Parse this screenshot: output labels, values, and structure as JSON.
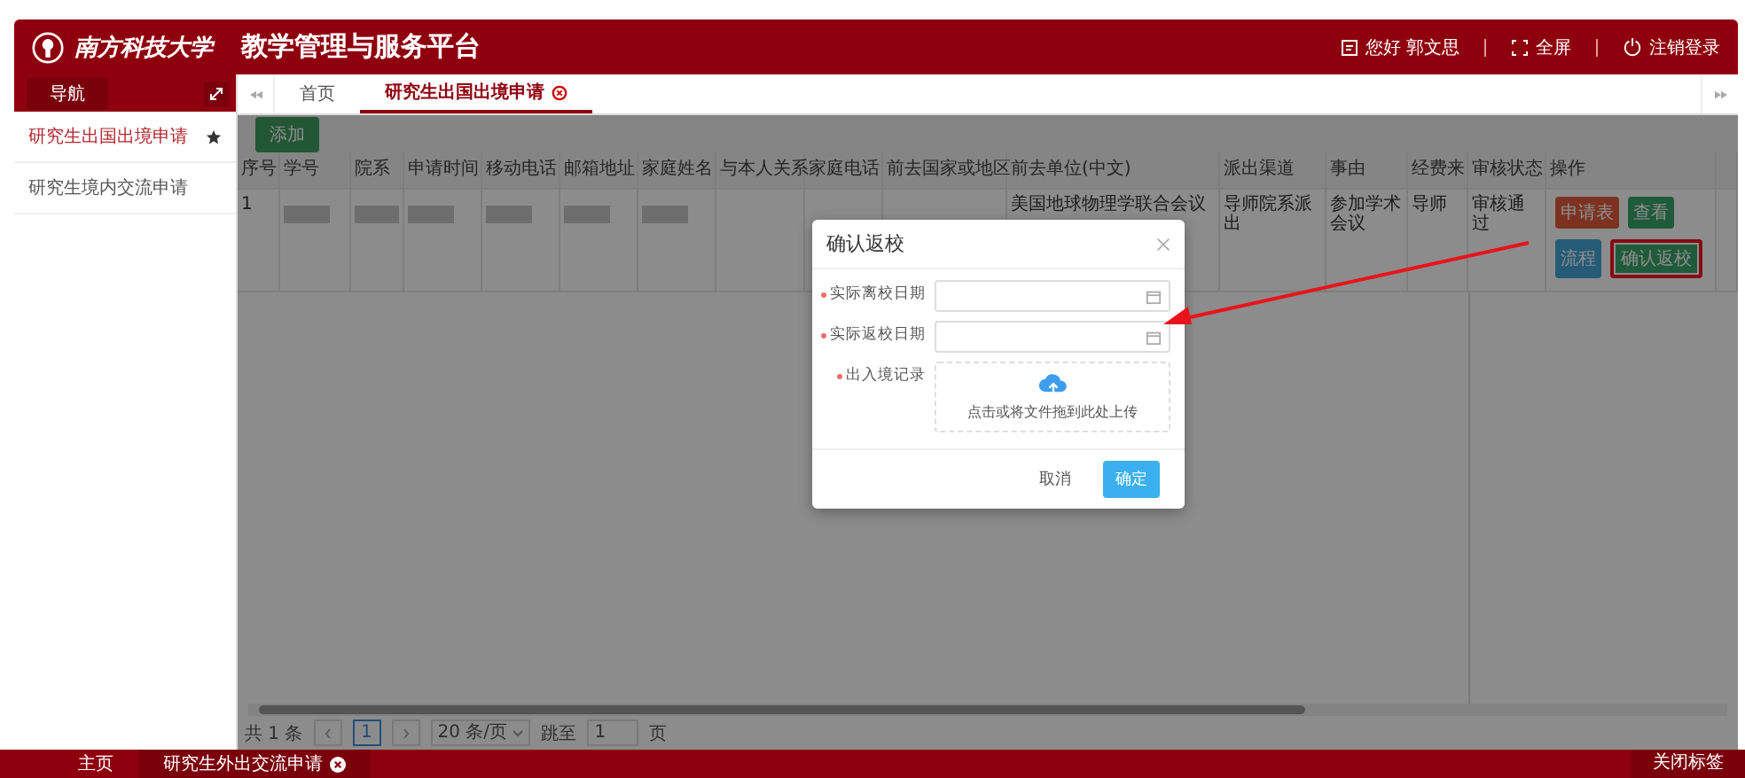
{
  "header": {
    "school_name": "南方科技大学",
    "title": "教学管理与服务平台",
    "greeting": "您好 郭文思",
    "fullscreen": "全屏",
    "logout": "注销登录"
  },
  "sidebar": {
    "nav_label": "导航",
    "items": [
      {
        "label": "研究生出国出境申请",
        "selected": true,
        "starred": true
      },
      {
        "label": "研究生境内交流申请",
        "selected": false,
        "starred": false
      }
    ]
  },
  "tabs": [
    {
      "label": "首页",
      "selected": false,
      "closable": false
    },
    {
      "label": "研究生出国出境申请",
      "selected": true,
      "closable": true
    }
  ],
  "toolbar": {
    "add": "添加"
  },
  "table": {
    "columns": [
      "序号",
      "学号",
      "院系",
      "申请时间",
      "移动电话",
      "邮箱地址",
      "家庭姓名",
      "与本人关系",
      "家庭电话",
      "前去国家或地区",
      "前去单位(中文)",
      "派出渠道",
      "事由",
      "经费来",
      "审核状态",
      "操作"
    ],
    "rows": [
      {
        "cells": [
          {
            "kind": "text",
            "text": "1"
          },
          {
            "kind": "blurred"
          },
          {
            "kind": "blurred"
          },
          {
            "kind": "blurred"
          },
          {
            "kind": "blurred"
          },
          {
            "kind": "blurred"
          },
          {
            "kind": "blurred"
          },
          {
            "kind": "empty"
          },
          {
            "kind": "empty"
          },
          {
            "kind": "empty"
          },
          {
            "kind": "text",
            "text": "美国地球物理学联合会议"
          },
          {
            "kind": "text",
            "text": "导师院系派出"
          },
          {
            "kind": "text",
            "text": "参加学术会议"
          },
          {
            "kind": "text",
            "text": "导师"
          },
          {
            "kind": "text",
            "text": "审核通过"
          },
          {
            "kind": "actions",
            "buttons": [
              {
                "label": "申请表",
                "kind": "danger",
                "highlighted": false
              },
              {
                "label": "查看",
                "kind": "success",
                "highlighted": false
              },
              {
                "label": "流程",
                "kind": "info",
                "highlighted": false
              },
              {
                "label": "确认返校",
                "kind": "success",
                "highlighted": true
              }
            ]
          }
        ]
      }
    ]
  },
  "pagination": {
    "total": "共 1 条",
    "page": "1",
    "page_size": "20 条/页",
    "jump_label": "跳至",
    "jump_value": "1",
    "page_unit": "页"
  },
  "dialog": {
    "title": "确认返校",
    "fields": [
      {
        "label": "实际离校日期",
        "required": true,
        "kind": "date"
      },
      {
        "label": "实际返校日期",
        "required": true,
        "kind": "date"
      },
      {
        "label": "出入境记录",
        "required": true,
        "kind": "upload",
        "hint": "点击或将文件拖到此处上传"
      }
    ],
    "cancel": "取消",
    "ok": "确定"
  },
  "bottom_bar": {
    "tabs": [
      {
        "label": "主页",
        "selected": false,
        "closable": false
      },
      {
        "label": "研究生外出交流申请",
        "selected": true,
        "closable": true
      }
    ],
    "close_tabs": "关闭标签"
  }
}
